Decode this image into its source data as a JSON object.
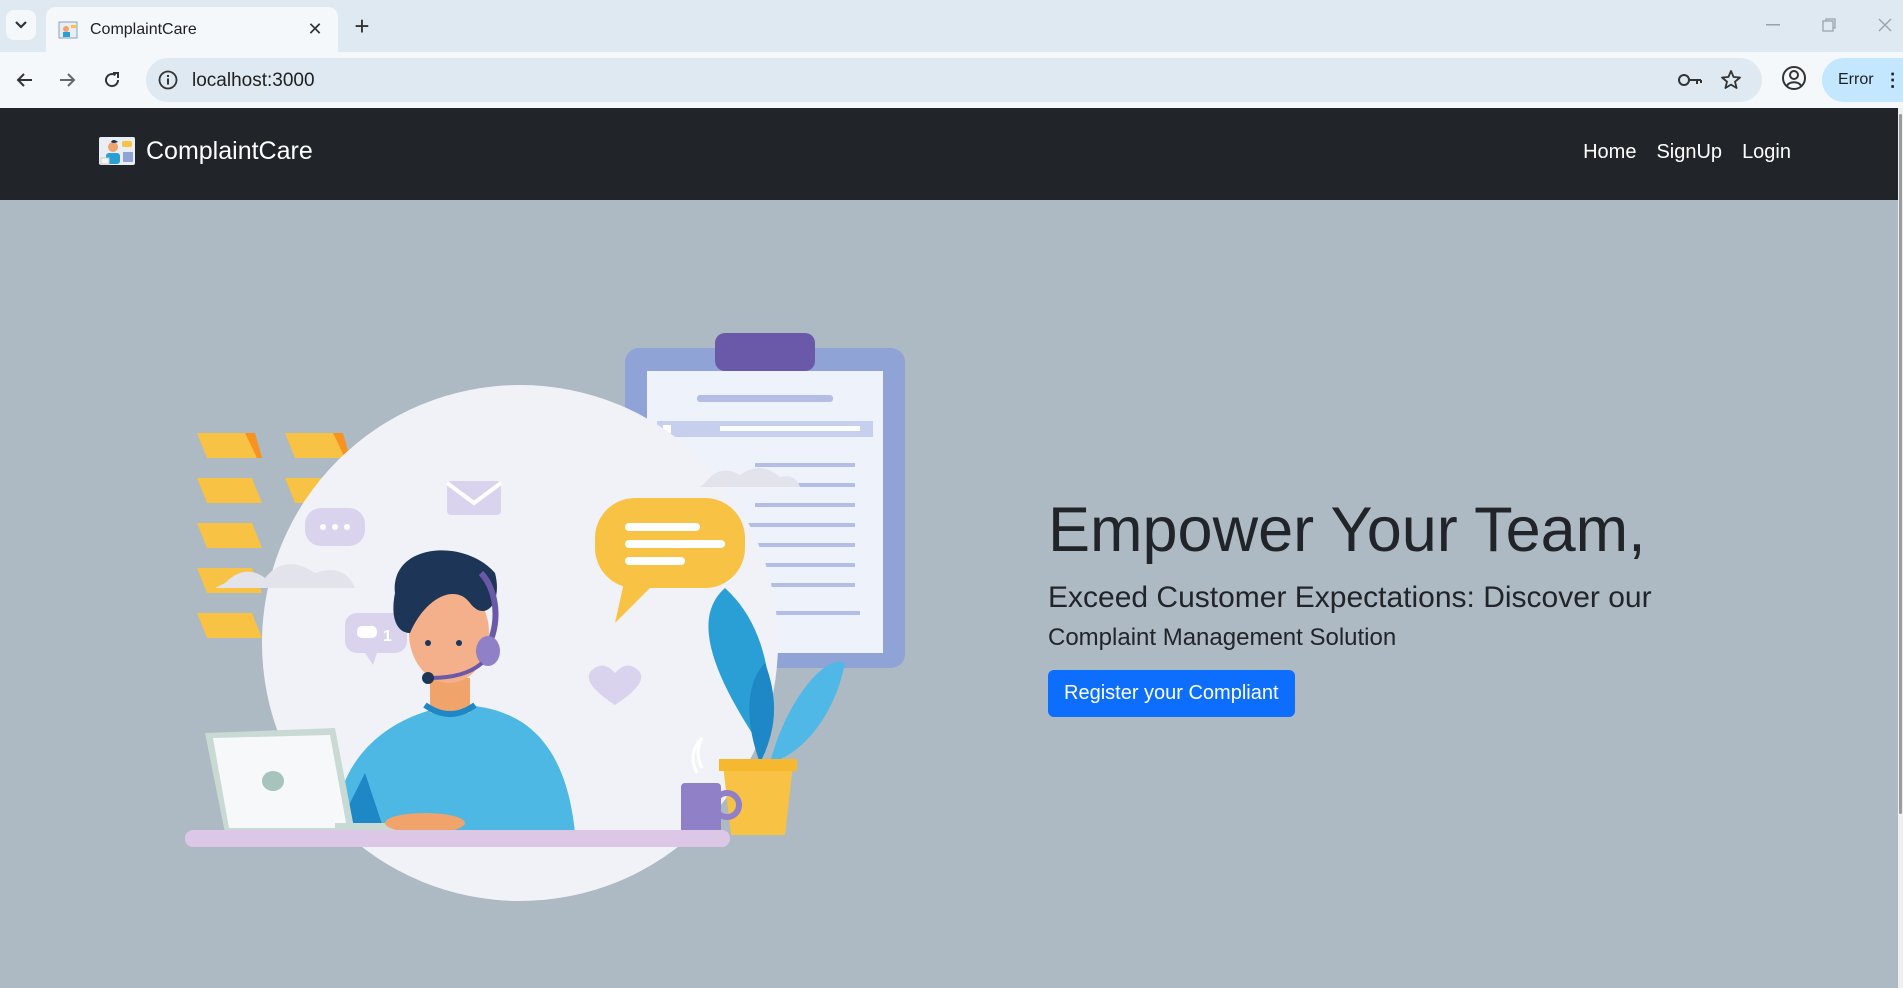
{
  "browser": {
    "tab_title": "ComplaintCare",
    "new_tab_symbol": "+",
    "close_symbol": "✕",
    "url": "localhost:3000",
    "error_label": "Error",
    "error_menu_symbol": "⋮"
  },
  "navbar": {
    "brand": "ComplaintCare",
    "links": [
      "Home",
      "SignUp",
      "Login"
    ]
  },
  "hero": {
    "title": "Empower Your Team,",
    "subtitle_line1": "Exceed Customer Expectations: Discover our",
    "subtitle_line2": "Complaint Management Solution",
    "cta_label": "Register your Compliant",
    "chat_badge_count": "1"
  },
  "colors": {
    "navbar_bg": "#212529",
    "page_bg": "#adb9c3",
    "primary": "#0d6efd",
    "accent_yellow": "#f8c244",
    "accent_purple": "#6a58a8"
  },
  "icons": [
    "tab-search-icon",
    "close-icon",
    "plus-icon",
    "back-arrow-icon",
    "forward-arrow-icon",
    "reload-icon",
    "info-icon",
    "key-icon",
    "star-icon",
    "profile-icon",
    "minimize-icon",
    "restore-icon",
    "window-close-icon"
  ]
}
